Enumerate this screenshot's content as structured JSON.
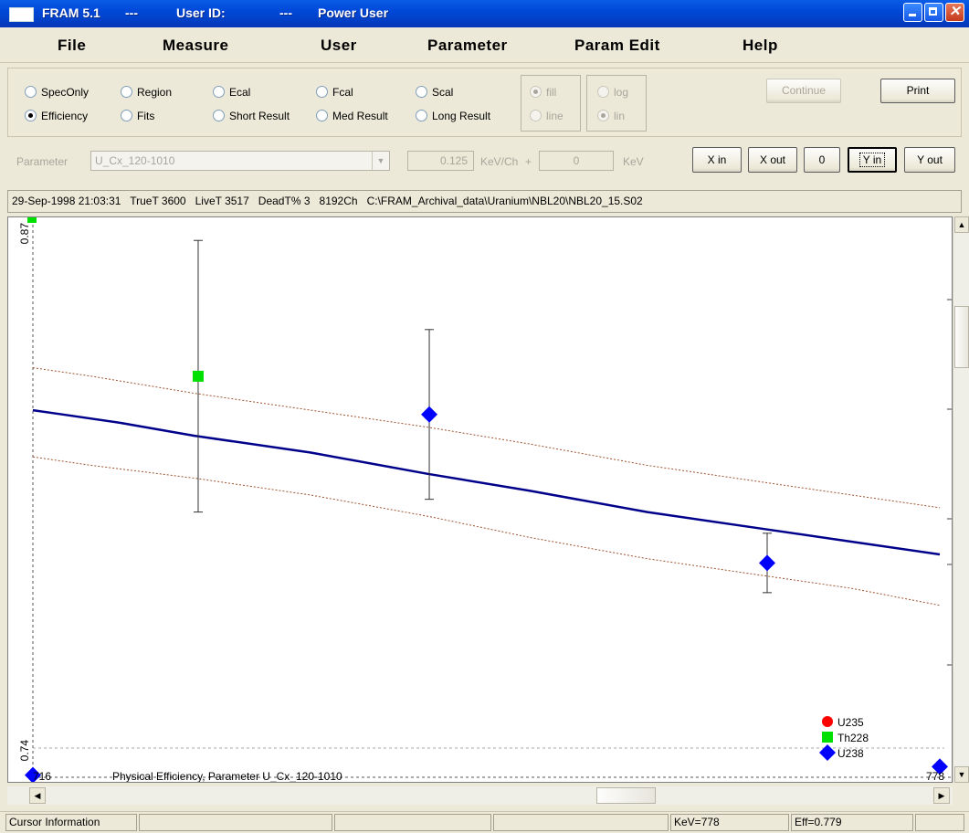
{
  "window": {
    "app": "FRAM 5.1",
    "sep1": "---",
    "user_label": "User ID:",
    "sep2": "---",
    "user": "Power User"
  },
  "menu": [
    "File",
    "Measure",
    "User",
    "Parameter",
    "Param Edit",
    "Help"
  ],
  "modes_row1": [
    "SpecOnly",
    "Region",
    "Ecal",
    "Fcal",
    "Scal"
  ],
  "modes_row2": [
    "Efficiency",
    "Fits",
    "Short Result",
    "Med Result",
    "Long Result"
  ],
  "selected_mode": "Efficiency",
  "draw_options": [
    "fill",
    "line"
  ],
  "scale_options": [
    "log",
    "lin"
  ],
  "buttons": {
    "continue": "Continue",
    "print": "Print",
    "x_in": "X in",
    "x_out": "X out",
    "zero": "0",
    "y_in": "Y in",
    "y_out": "Y out"
  },
  "parameter": {
    "label": "Parameter",
    "value": "U_Cx_120-1010",
    "kev_per_ch": "0.125",
    "kev_per_ch_unit": "KeV/Ch",
    "plus": "+",
    "offset": "0",
    "offset_unit": "KeV"
  },
  "spectrum_info": {
    "datetime": "29-Sep-1998 21:03:31",
    "truet": "TrueT 3600",
    "livet": "LiveT 3517",
    "deadt": "DeadT% 3",
    "channels": "8192Ch",
    "file": "C:\\FRAM_Archival_data\\Uranium\\NBL20\\NBL20_15.S02"
  },
  "chart_data": {
    "type": "scatter",
    "title": "Physical Efficiency, Parameter U_Cx_120-1010",
    "xlim": [
      716,
      778
    ],
    "ylim": [
      0.74,
      0.87
    ],
    "x_tick_labels": [
      "716",
      "778"
    ],
    "y_tick_labels": [
      "0.87",
      "0.74"
    ],
    "series": [
      {
        "name": "U235",
        "color": "#ff0000",
        "marker": "circle",
        "points": []
      },
      {
        "name": "Th228",
        "color": "#00e000",
        "marker": "square",
        "points": [
          {
            "x": 727.3,
            "y": 0.833,
            "err": 0.032
          }
        ]
      },
      {
        "name": "U238",
        "color": "#0000ff",
        "marker": "diamond",
        "points": [
          {
            "x": 743.1,
            "y": 0.824,
            "err": 0.02
          },
          {
            "x": 766.2,
            "y": 0.789,
            "err": 0.007
          },
          {
            "x": 716.0,
            "y": 0.739
          },
          {
            "x": 778.0,
            "y": 0.741
          }
        ]
      }
    ],
    "fit_curve": {
      "color": "#00008b",
      "points": [
        [
          716,
          0.825
        ],
        [
          718,
          0.824
        ],
        [
          722,
          0.822
        ],
        [
          727,
          0.819
        ],
        [
          735,
          0.815
        ],
        [
          743,
          0.81
        ],
        [
          750,
          0.806
        ],
        [
          758,
          0.801
        ],
        [
          766,
          0.797
        ],
        [
          772,
          0.794
        ],
        [
          778,
          0.791
        ]
      ]
    },
    "upper_band": {
      "color": "#a0522d",
      "points": [
        [
          716,
          0.835
        ],
        [
          720,
          0.833
        ],
        [
          727,
          0.829
        ],
        [
          735,
          0.825
        ],
        [
          743,
          0.821
        ],
        [
          750,
          0.817
        ],
        [
          758,
          0.812
        ],
        [
          766,
          0.808
        ],
        [
          772,
          0.805
        ],
        [
          778,
          0.802
        ]
      ]
    },
    "lower_band": {
      "color": "#a0522d",
      "points": [
        [
          716,
          0.814
        ],
        [
          720,
          0.812
        ],
        [
          727,
          0.809
        ],
        [
          735,
          0.805
        ],
        [
          743,
          0.8
        ],
        [
          750,
          0.795
        ],
        [
          758,
          0.79
        ],
        [
          766,
          0.786
        ],
        [
          772,
          0.783
        ],
        [
          778,
          0.779
        ]
      ]
    },
    "legend_position": "bottom-right"
  },
  "statusbar": {
    "cursor": "Cursor Information",
    "kev": "KeV=778",
    "eff": "Eff=0.779"
  }
}
